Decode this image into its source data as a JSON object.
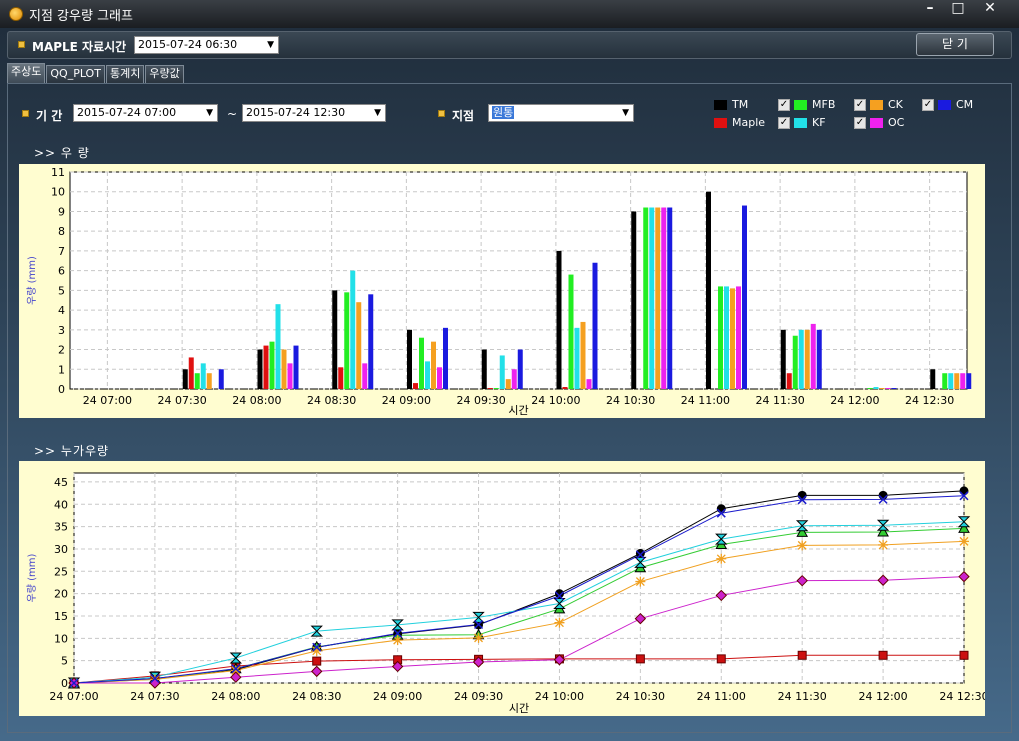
{
  "window": {
    "title": "지점 강우량 그래프",
    "controls": [
      "–",
      "□",
      "✕"
    ]
  },
  "toolbar": {
    "maple_label": "MAPLE 자료시간",
    "maple_time": "2015-07-24 06:30",
    "close_label": "닫 기"
  },
  "tabs": [
    "주상도",
    "QQ_PLOT",
    "통계치",
    "우량값"
  ],
  "filter": {
    "period_label": "기 간",
    "start": "2015-07-24 07:00",
    "tilde": "~",
    "end": "2015-07-24 12:30",
    "station_label": "지점",
    "station": "원통"
  },
  "legend": [
    {
      "name": "TM",
      "color": "#000000",
      "checkbox": false
    },
    {
      "name": "Maple",
      "color": "#e01010",
      "checkbox": false
    },
    {
      "name": "MFB",
      "color": "#22ee22",
      "checkbox": true
    },
    {
      "name": "KF",
      "color": "#22e0e8",
      "checkbox": true
    },
    {
      "name": "CK",
      "color": "#f5a020",
      "checkbox": true
    },
    {
      "name": "OC",
      "color": "#ee22ee",
      "checkbox": true
    },
    {
      "name": "CM",
      "color": "#1a1adf",
      "checkbox": true
    }
  ],
  "sections": {
    "rain": ">> 우  량",
    "cumulative": ">> 누가우량"
  },
  "chart_data": [
    {
      "type": "bar",
      "title": "",
      "xlabel": "시간",
      "ylabel": "우량 (mm)",
      "ylim": [
        0,
        11
      ],
      "yticks": [
        0,
        1,
        2,
        3,
        4,
        5,
        6,
        7,
        8,
        9,
        10,
        11
      ],
      "categories": [
        "24 07:00",
        "24 07:30",
        "24 08:00",
        "24 08:30",
        "24 09:00",
        "24 09:30",
        "24 10:00",
        "24 10:30",
        "24 11:00",
        "24 11:30",
        "24 12:00",
        "24 12:30"
      ],
      "series": [
        {
          "name": "TM",
          "values": [
            0,
            1.0,
            2.0,
            5.0,
            3.0,
            2.0,
            7.0,
            9.0,
            10.0,
            3.0,
            0,
            1.0
          ]
        },
        {
          "name": "Maple",
          "values": [
            0,
            1.6,
            2.2,
            1.1,
            0.3,
            0.05,
            0.1,
            0,
            0,
            0.8,
            0,
            0
          ]
        },
        {
          "name": "MFB",
          "values": [
            0,
            0.8,
            2.4,
            4.9,
            2.6,
            0.05,
            5.8,
            9.2,
            5.2,
            2.7,
            0.05,
            0.8
          ]
        },
        {
          "name": "KF",
          "values": [
            0,
            1.3,
            4.3,
            6.0,
            1.4,
            1.7,
            3.1,
            9.2,
            5.2,
            3.0,
            0.1,
            0.8
          ]
        },
        {
          "name": "CK",
          "values": [
            0,
            0.8,
            2.0,
            4.4,
            2.4,
            0.5,
            3.4,
            9.2,
            5.1,
            3.0,
            0.05,
            0.8
          ]
        },
        {
          "name": "OC",
          "values": [
            0,
            0,
            1.3,
            1.3,
            1.1,
            1.0,
            0.5,
            9.2,
            5.2,
            3.3,
            0.05,
            0.8
          ]
        },
        {
          "name": "CM",
          "values": [
            0,
            1.0,
            2.2,
            4.8,
            3.1,
            2.0,
            6.4,
            9.2,
            9.3,
            3.0,
            0.05,
            0.8
          ]
        }
      ]
    },
    {
      "type": "line",
      "title": "",
      "xlabel": "시간",
      "ylabel": "우량 (mm)",
      "ylim": [
        0,
        47
      ],
      "yticks": [
        0,
        5,
        10,
        15,
        20,
        25,
        30,
        35,
        40,
        45
      ],
      "categories": [
        "24 07:00",
        "24 07:30",
        "24 08:00",
        "24 08:30",
        "24 09:00",
        "24 09:30",
        "24 10:00",
        "24 10:30",
        "24 11:00",
        "24 11:30",
        "24 12:00",
        "24 12:30"
      ],
      "series": [
        {
          "name": "TM",
          "marker": "circle",
          "values": [
            0,
            1,
            3,
            8,
            11,
            13,
            20,
            29,
            39,
            42,
            42,
            43
          ]
        },
        {
          "name": "Maple",
          "marker": "square",
          "values": [
            0,
            1.6,
            3.8,
            4.9,
            5.2,
            5.3,
            5.4,
            5.4,
            5.4,
            6.2,
            6.2,
            6.2
          ]
        },
        {
          "name": "MFB",
          "marker": "triangle",
          "values": [
            0,
            0.8,
            3.2,
            8.1,
            10.7,
            10.8,
            16.6,
            25.8,
            31.0,
            33.7,
            33.8,
            34.6
          ]
        },
        {
          "name": "KF",
          "marker": "hourglass",
          "values": [
            0,
            1.3,
            5.6,
            11.6,
            13.0,
            14.7,
            17.8,
            27.0,
            32.2,
            35.2,
            35.3,
            36.1
          ]
        },
        {
          "name": "CK",
          "marker": "star",
          "values": [
            0,
            0.8,
            2.8,
            7.2,
            9.6,
            10.1,
            13.5,
            22.7,
            27.8,
            30.8,
            30.9,
            31.7
          ]
        },
        {
          "name": "OC",
          "marker": "diamond",
          "values": [
            0,
            0,
            1.3,
            2.6,
            3.7,
            4.7,
            5.2,
            14.4,
            19.6,
            22.9,
            23.0,
            23.8
          ]
        },
        {
          "name": "CM",
          "marker": "x",
          "values": [
            0,
            1.0,
            3.2,
            8.0,
            11.1,
            13.1,
            19.5,
            28.7,
            38.0,
            41.0,
            41.1,
            41.9
          ]
        }
      ]
    }
  ]
}
